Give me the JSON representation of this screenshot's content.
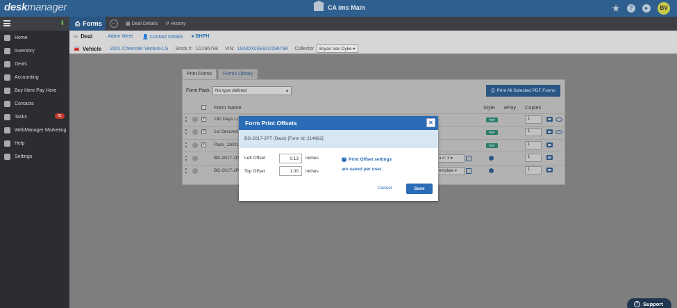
{
  "topbar": {
    "logo_a": "desk",
    "logo_b": "manager",
    "app_title": "CA ims Main",
    "avatar_initials": "BV"
  },
  "subbar": {
    "forms_label": "Forms",
    "deal_details": "Deal Details",
    "history": "History"
  },
  "sidebar": {
    "items": [
      {
        "label": "Home"
      },
      {
        "label": "Inventory"
      },
      {
        "label": "Deals"
      },
      {
        "label": "Accounting"
      },
      {
        "label": "Buy Here Pay Here"
      },
      {
        "label": "Contacts"
      },
      {
        "label": "Tasks",
        "badge": "81"
      },
      {
        "label": "WebManager Marketing"
      },
      {
        "label": "Help"
      },
      {
        "label": "Settings"
      }
    ]
  },
  "deal": {
    "deal_label": "Deal",
    "customer": "Adam West",
    "contact_details": "Contact Details",
    "deal_type": "BHPH",
    "vehicle_label": "Vehicle",
    "vehicle": "2001 Chevrolet Venture LS",
    "stock_label": "Stock #:",
    "stock": "1D196798",
    "vin_label": "VIN:",
    "vin": "1GNDX03E91D196798",
    "collector_label": "Collector",
    "collector": "Bryan Van Dyke"
  },
  "forms_panel": {
    "tabs": [
      "Print Forms",
      "Forms Library"
    ],
    "form_pack_label": "Form Pack",
    "form_pack_value": "No type defined",
    "print_all_button": "Print All Selected PDF Forms",
    "headers": {
      "name": "Form Name",
      "style": "Style",
      "epay": "ePay",
      "copies": "Copies"
    },
    "rows": [
      {
        "name": "180 Days Li",
        "style": "PDF",
        "copies": "1"
      },
      {
        "name": "1st Secured",
        "style": "PDF",
        "copies": "1"
      },
      {
        "name": "Pack_11001",
        "style": "PDF",
        "copies": "1"
      },
      {
        "name": "BG-2017-2P",
        "select": "a #: 1",
        "copies": "1"
      },
      {
        "name": "BG-2017-2P",
        "select": "emplate",
        "copies": "1"
      }
    ]
  },
  "modal": {
    "title": "Form Print Offsets",
    "subtitle": "BG-2017-2PT (Back) [Form Id: 214662]",
    "left_label": "Left Offset",
    "left_value": "0.13",
    "top_label": "Top Offset",
    "top_value": "1.00",
    "unit": "inches",
    "note_line1": "Print Offset settings",
    "note_line2": "are saved per user.",
    "cancel": "Cancel",
    "save": "Save"
  },
  "support": "Support",
  "colors": {
    "primary": "#2a6cb5",
    "topbar": "#2e5f8f",
    "sidebar": "#2b2d31",
    "pdf_badge": "#2e7d6b",
    "task_badge": "#c0392b"
  }
}
